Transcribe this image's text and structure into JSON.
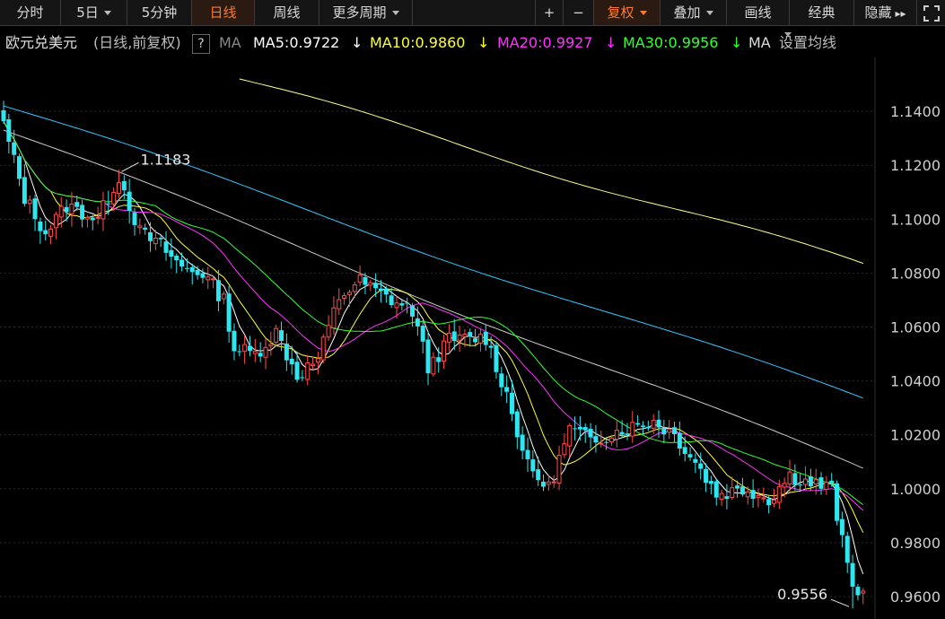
{
  "toolbar": {
    "fenshi": "分时",
    "wuri": "5日",
    "wufenzhong": "5分钟",
    "rixian": "日线",
    "zhouxian": "周线",
    "gengduo": "更多周期",
    "plus": "+",
    "minus": "−",
    "fuquan": "复权",
    "diejia": "叠加",
    "huaxian": "画线",
    "jingdian": "经典",
    "yincang": "隐藏"
  },
  "legend": {
    "name": "欧元兑美元",
    "mode": "(日线,前复权)",
    "help": "?",
    "ma": "MA",
    "ma5": "MA5:0.9722",
    "ma10": "MA10:0.9860",
    "ma20": "MA20:0.9927",
    "ma30": "MA30:0.9956",
    "ma_cut": "MA",
    "settings": "设置均线"
  },
  "colors": {
    "up": "#ff4d4d",
    "down": "#2ee6f0",
    "ma5": "#ffffff",
    "ma10": "#ffff33",
    "ma20": "#ff33ff",
    "ma30": "#33ff33",
    "ma60": "#cccccc",
    "ma120": "#33c8ff",
    "ma250": "#ffff88",
    "grid": "#2a2a2a",
    "accent": "#ff7a2e"
  },
  "chart_data": {
    "type": "candlestick",
    "ylim": [
      0.953,
      1.16
    ],
    "yticks": [
      "1.1400",
      "1.1200",
      "1.1000",
      "1.0800",
      "1.0600",
      "1.0400",
      "1.0200",
      "1.0000",
      "0.9800",
      "0.9600"
    ],
    "grid": true,
    "annotations": [
      {
        "text": "1.1183",
        "value": 1.1183,
        "candle_index": 22
      },
      {
        "text": "0.9556",
        "value": 0.9556,
        "candle_index": 162
      }
    ],
    "anchors": [
      [
        0,
        1.135
      ],
      [
        4,
        1.108
      ],
      [
        8,
        1.095
      ],
      [
        12,
        1.105
      ],
      [
        18,
        1.1
      ],
      [
        22,
        1.116
      ],
      [
        26,
        1.095
      ],
      [
        30,
        1.09
      ],
      [
        34,
        1.082
      ],
      [
        38,
        1.08
      ],
      [
        42,
        1.07
      ],
      [
        44,
        1.052
      ],
      [
        48,
        1.05
      ],
      [
        52,
        1.058
      ],
      [
        56,
        1.042
      ],
      [
        60,
        1.048
      ],
      [
        64,
        1.071
      ],
      [
        68,
        1.077
      ],
      [
        72,
        1.072
      ],
      [
        78,
        1.066
      ],
      [
        81,
        1.045
      ],
      [
        85,
        1.055
      ],
      [
        92,
        1.056
      ],
      [
        96,
        1.035
      ],
      [
        100,
        1.008
      ],
      [
        104,
        1.0
      ],
      [
        108,
        1.022
      ],
      [
        112,
        1.018
      ],
      [
        118,
        1.022
      ],
      [
        124,
        1.025
      ],
      [
        128,
        1.02
      ],
      [
        132,
        1.01
      ],
      [
        136,
        0.998
      ],
      [
        142,
        1.0
      ],
      [
        146,
        0.996
      ],
      [
        150,
        1.005
      ],
      [
        154,
        1.002
      ],
      [
        158,
        1.0
      ],
      [
        160,
        0.98
      ],
      [
        162,
        0.963
      ],
      [
        164,
        0.962
      ]
    ],
    "ma_series": [
      {
        "name": "MA5",
        "value_text": "0.9722",
        "period": 5
      },
      {
        "name": "MA10",
        "value_text": "0.9860",
        "period": 10
      },
      {
        "name": "MA20",
        "value_text": "0.9927",
        "period": 20
      },
      {
        "name": "MA30",
        "value_text": "0.9956",
        "period": 30
      }
    ],
    "long_ma": [
      {
        "key": "ma60",
        "start": [
          0,
          1.133
        ],
        "end": [
          164,
          1.007
        ]
      },
      {
        "key": "ma120",
        "start": [
          0,
          1.142
        ],
        "end": [
          164,
          1.033
        ]
      },
      {
        "key": "ma250",
        "start": [
          45,
          1.152
        ],
        "end": [
          164,
          1.083
        ]
      }
    ]
  }
}
